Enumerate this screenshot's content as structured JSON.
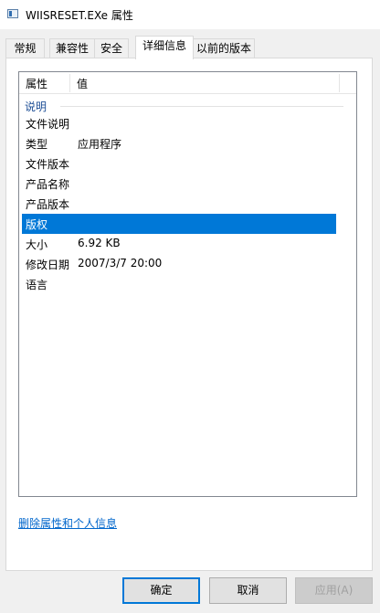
{
  "window": {
    "title": "WIISRESET.EXe 属性",
    "icon": "application-window-icon"
  },
  "tabs": [
    {
      "label": "常规",
      "active": false
    },
    {
      "label": "兼容性",
      "active": false
    },
    {
      "label": "安全",
      "active": false
    },
    {
      "label": "详细信息",
      "active": true
    },
    {
      "label": "以前的版本",
      "active": false
    }
  ],
  "details": {
    "columns": {
      "property": "属性",
      "value": "值"
    },
    "group": "说明",
    "rows": [
      {
        "name": "文件说明",
        "value": ""
      },
      {
        "name": "类型",
        "value": "应用程序"
      },
      {
        "name": "文件版本",
        "value": ""
      },
      {
        "name": "产品名称",
        "value": ""
      },
      {
        "name": "产品版本",
        "value": ""
      },
      {
        "name": "版权",
        "value": "",
        "selected": true
      },
      {
        "name": "大小",
        "value": "6.92 KB"
      },
      {
        "name": "修改日期",
        "value": "2007/3/7 20:00"
      },
      {
        "name": "语言",
        "value": ""
      }
    ]
  },
  "remove_link": "删除属性和个人信息",
  "buttons": {
    "ok": "确定",
    "cancel": "取消",
    "apply": "应用(A)"
  },
  "colors": {
    "selection": "#0078d7",
    "link": "#0066cc",
    "group_label": "#1e4f96"
  }
}
